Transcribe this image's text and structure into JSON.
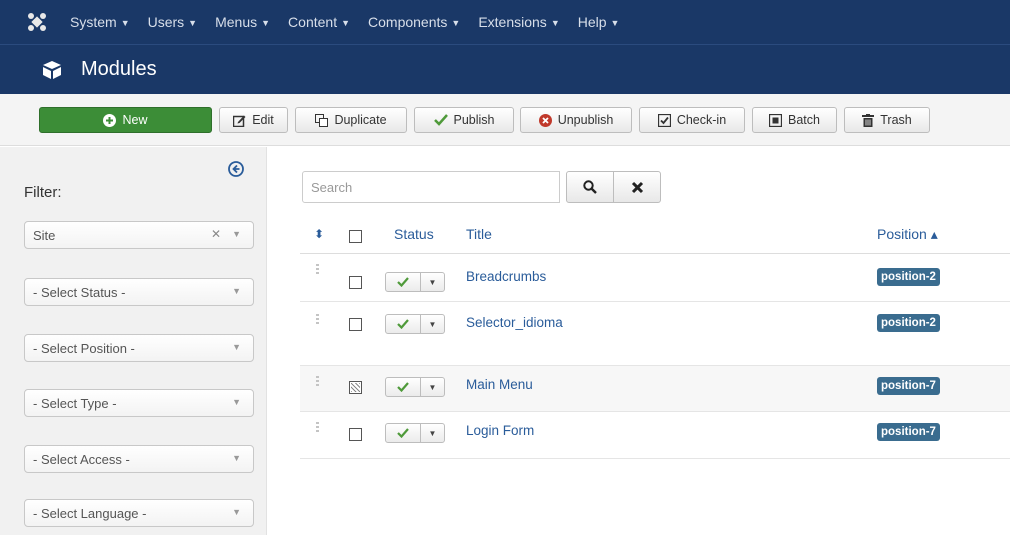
{
  "navbar": {
    "logo": "joomla-logo-icon",
    "menus": [
      {
        "label": "System"
      },
      {
        "label": "Users"
      },
      {
        "label": "Menus"
      },
      {
        "label": "Content"
      },
      {
        "label": "Components"
      },
      {
        "label": "Extensions"
      },
      {
        "label": "Help"
      }
    ]
  },
  "titlebar": {
    "icon": "cube-icon",
    "title": "Modules"
  },
  "toolbar": {
    "buttons": [
      {
        "label": "New",
        "icon": "plus-circle-icon"
      },
      {
        "label": "Edit",
        "icon": "edit-icon"
      },
      {
        "label": "Duplicate",
        "icon": "copy-icon"
      },
      {
        "label": "Publish",
        "icon": "check-icon"
      },
      {
        "label": "Unpublish",
        "icon": "unpublish-icon"
      },
      {
        "label": "Check-in",
        "icon": "checkbox-icon"
      },
      {
        "label": "Batch",
        "icon": "batch-icon"
      },
      {
        "label": "Trash",
        "icon": "trash-icon"
      }
    ]
  },
  "sidebar": {
    "filter_label": "Filter:",
    "client": "Site",
    "selects": [
      {
        "label": "- Select Status -"
      },
      {
        "label": "- Select Position -"
      },
      {
        "label": "- Select Type -"
      },
      {
        "label": "- Select Access -"
      },
      {
        "label": "- Select Language -"
      }
    ]
  },
  "search": {
    "placeholder": "Search",
    "value": ""
  },
  "table": {
    "headers": {
      "status": "Status",
      "title": "Title",
      "position": "Position ▴"
    },
    "rows": [
      {
        "title": "Breadcrumbs",
        "position": "position-2",
        "checked": false
      },
      {
        "title": "Selector_idioma",
        "position": "position-2",
        "checked": false
      },
      {
        "title": "Main Menu",
        "position": "position-7",
        "checked": true
      },
      {
        "title": "Login Form",
        "position": "position-7",
        "checked": false
      }
    ]
  },
  "colors": {
    "navbar_bg": "#1a3867",
    "new_button": "#3c8d37",
    "link": "#2a5c9a",
    "badge": "#3a6c8f",
    "published_check": "#4f9a3a",
    "unpublish_icon": "#c0392b"
  }
}
